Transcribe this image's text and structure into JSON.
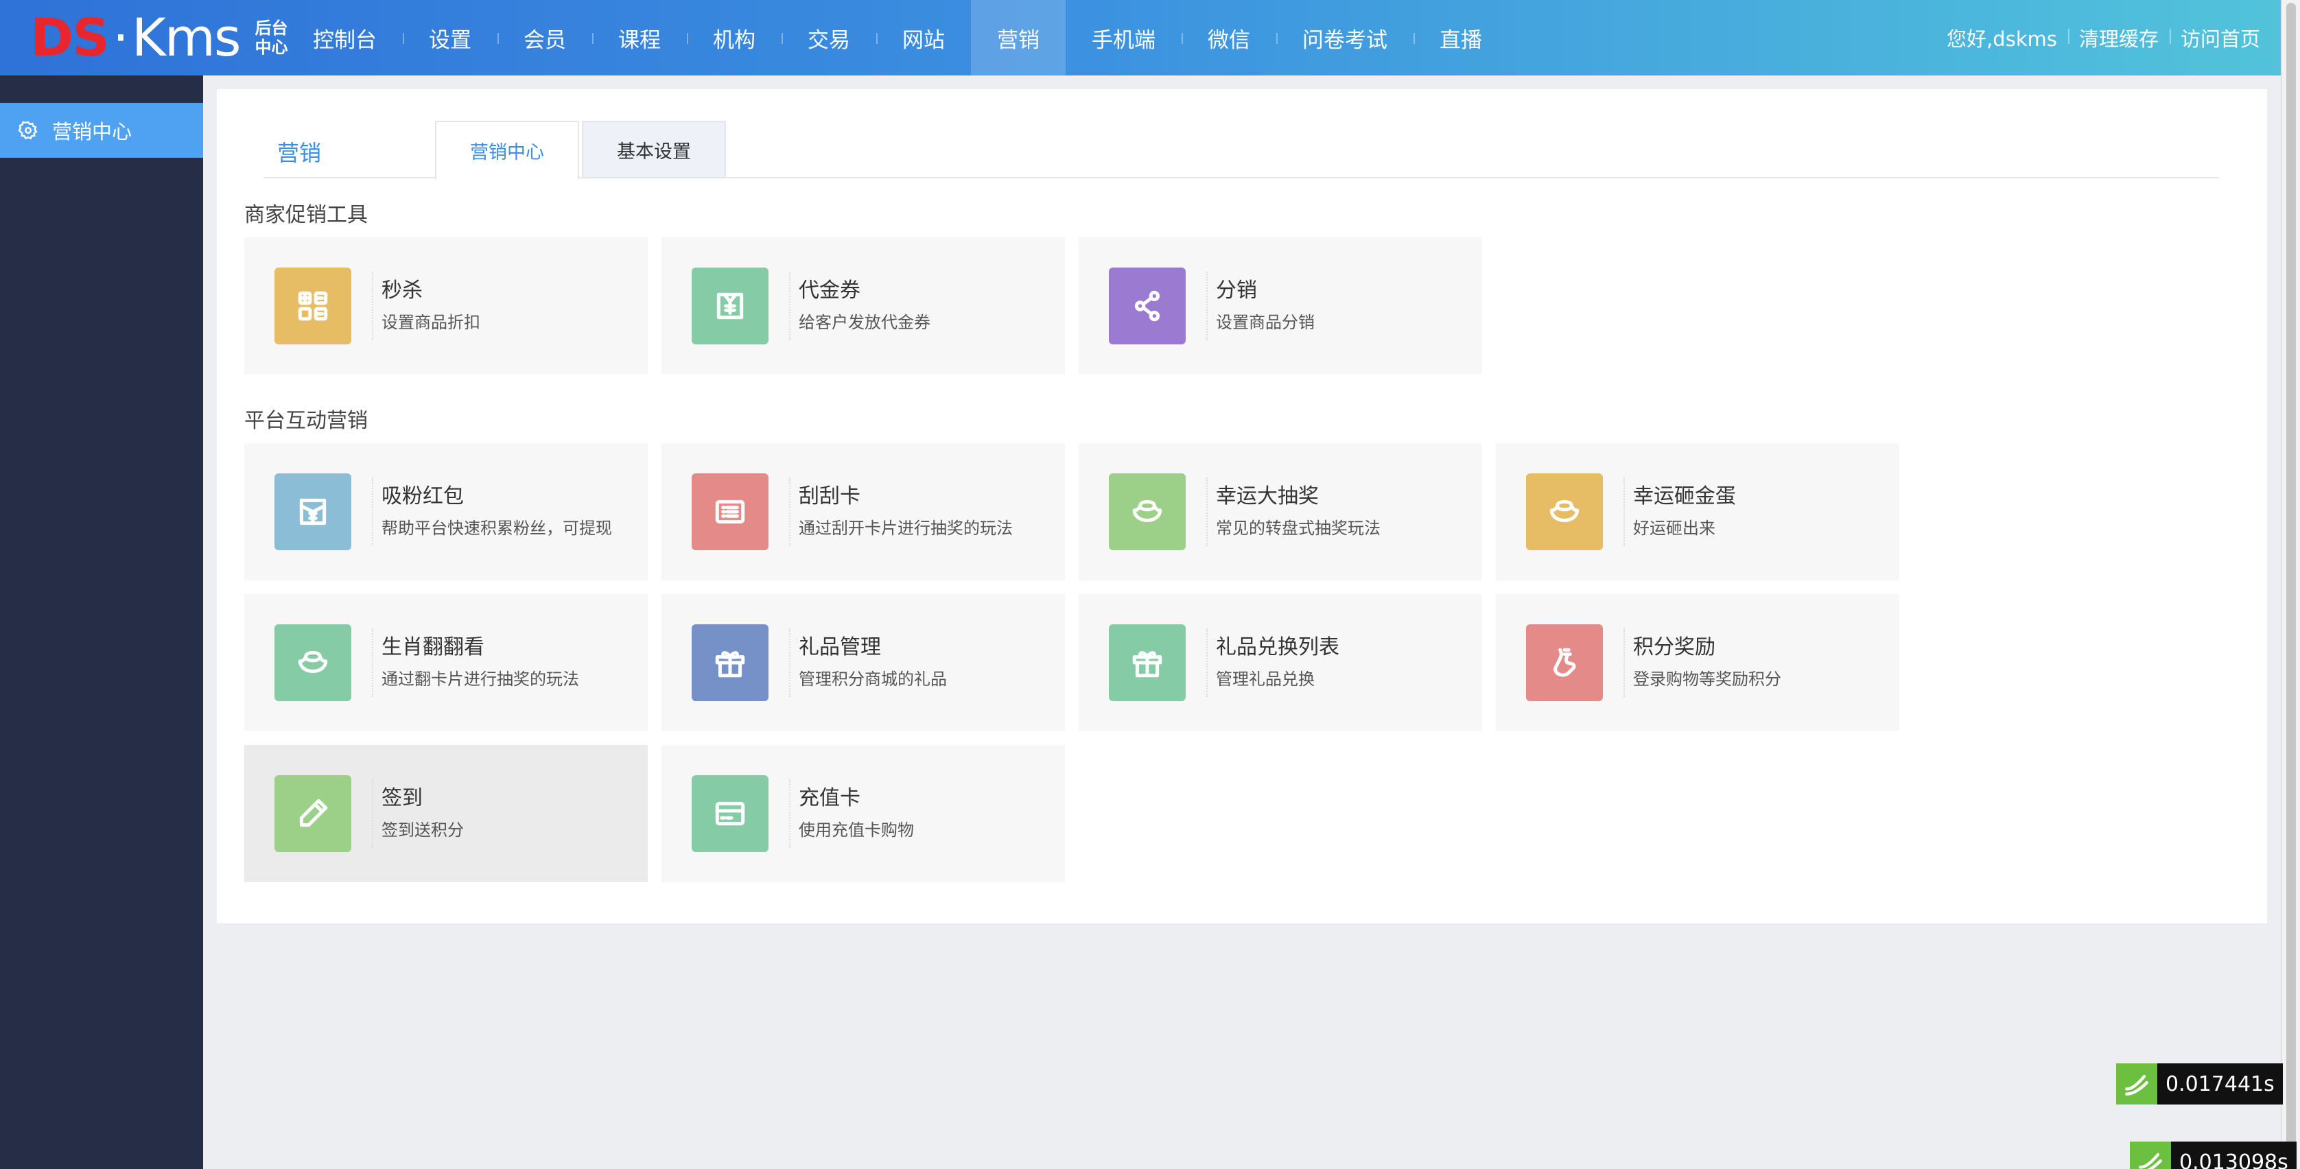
{
  "logo": {
    "ds": "DS",
    "dot": "·",
    "kms": "Kms",
    "sub_line1": "后台",
    "sub_line2": "中心"
  },
  "nav": [
    {
      "label": "控制台"
    },
    {
      "label": "设置"
    },
    {
      "label": "会员"
    },
    {
      "label": "课程"
    },
    {
      "label": "机构"
    },
    {
      "label": "交易"
    },
    {
      "label": "网站"
    },
    {
      "label": "营销"
    },
    {
      "label": "手机端"
    },
    {
      "label": "微信"
    },
    {
      "label": "问卷考试"
    },
    {
      "label": "直播"
    }
  ],
  "nav_active": "营销",
  "top_right": {
    "greeting": "您好,dskms",
    "clear_cache": "清理缓存",
    "visit_home": "访问首页"
  },
  "sidebar": {
    "items": [
      {
        "label": "营销中心",
        "icon": "gear-icon"
      }
    ]
  },
  "tabs": {
    "title": "营销",
    "items": [
      {
        "label": "营销中心"
      },
      {
        "label": "基本设置"
      }
    ]
  },
  "sections": [
    {
      "title": "商家促销工具",
      "cards": [
        {
          "title": "秒杀",
          "desc": "设置商品折扣",
          "icon": "grid-icon",
          "color": "#e6bd64"
        },
        {
          "title": "代金券",
          "desc": "给客户发放代金券",
          "icon": "voucher-icon",
          "color": "#85cba6"
        },
        {
          "title": "分销",
          "desc": "设置商品分销",
          "icon": "share-icon",
          "color": "#9b7bd1"
        }
      ]
    },
    {
      "title": "平台互动营销",
      "cards": [
        {
          "title": "吸粉红包",
          "desc": "帮助平台快速积累粉丝，可提现",
          "icon": "red-envelope-icon",
          "color": "#8cbdd6"
        },
        {
          "title": "刮刮卡",
          "desc": "通过刮开卡片进行抽奖的玩法",
          "icon": "card-list-icon",
          "color": "#e48a88"
        },
        {
          "title": "幸运大抽奖",
          "desc": "常见的转盘式抽奖玩法",
          "icon": "ingot-icon",
          "color": "#9ccf88"
        },
        {
          "title": "幸运砸金蛋",
          "desc": "好运砸出来",
          "icon": "ingot-icon",
          "color": "#e6bd64"
        },
        {
          "title": "生肖翻翻看",
          "desc": "通过翻卡片进行抽奖的玩法",
          "icon": "ingot-icon",
          "color": "#85cba6"
        },
        {
          "title": "礼品管理",
          "desc": "管理积分商城的礼品",
          "icon": "gift-icon",
          "color": "#7591c8"
        },
        {
          "title": "礼品兑换列表",
          "desc": "管理礼品兑换",
          "icon": "gift-icon",
          "color": "#85cba6"
        },
        {
          "title": "积分奖励",
          "desc": "登录购物等奖励积分",
          "icon": "foot-icon",
          "color": "#e48a88"
        },
        {
          "title": "签到",
          "desc": "签到送积分",
          "icon": "pencil-icon",
          "color": "#9ccf88"
        },
        {
          "title": "充值卡",
          "desc": "使用充值卡购物",
          "icon": "recharge-card-icon",
          "color": "#85cba6"
        }
      ]
    }
  ],
  "timers": [
    {
      "value": "0.017441s"
    },
    {
      "value": "0.013098s"
    }
  ]
}
